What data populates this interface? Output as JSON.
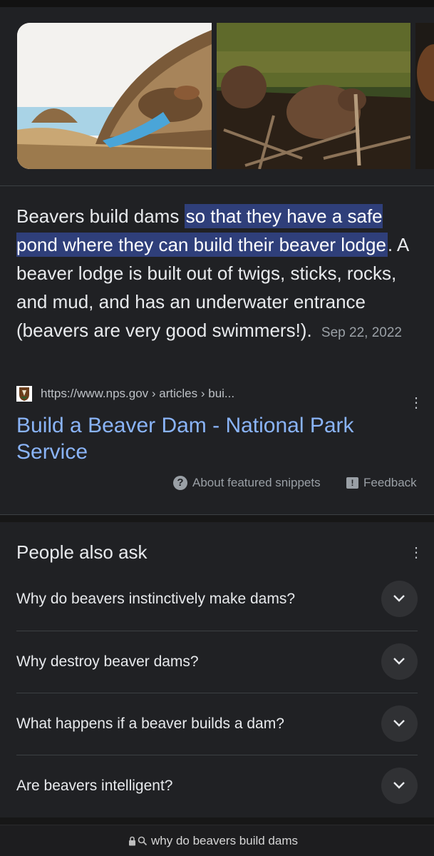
{
  "snippet": {
    "answer_lead": "Beavers build dams ",
    "answer_highlight": "so that they have a safe pond where they can build their beaver lodge",
    "answer_rest": ". A beaver lodge is built out of twigs, sticks, rocks, and mud, and has an underwater entrance (beavers are very good swimmers!).",
    "date": "Sep 22, 2022",
    "source_url": "https://www.nps.gov › articles › bui...",
    "result_title": "Build a Beaver Dam - National Park Service",
    "about_label": "About featured snippets",
    "feedback_label": "Feedback"
  },
  "people_also_ask": {
    "title": "People also ask",
    "questions": [
      "Why do beavers instinctively make dams?",
      "Why destroy beaver dams?",
      "What happens if a beaver builds a dam?",
      "Are beavers intelligent?"
    ]
  },
  "search_bar": {
    "query": "why do beavers build dams"
  },
  "icons": {
    "favicon": "nps-arrowhead-icon",
    "more": "more-vert-icon",
    "about": "help-circle-icon",
    "feedback": "feedback-icon",
    "expand": "chevron-down-icon",
    "lock": "lock-icon",
    "search": "search-icon"
  },
  "colors": {
    "background": "#202124",
    "highlight": "#2f3f7a",
    "link": "#8ab4f8"
  }
}
